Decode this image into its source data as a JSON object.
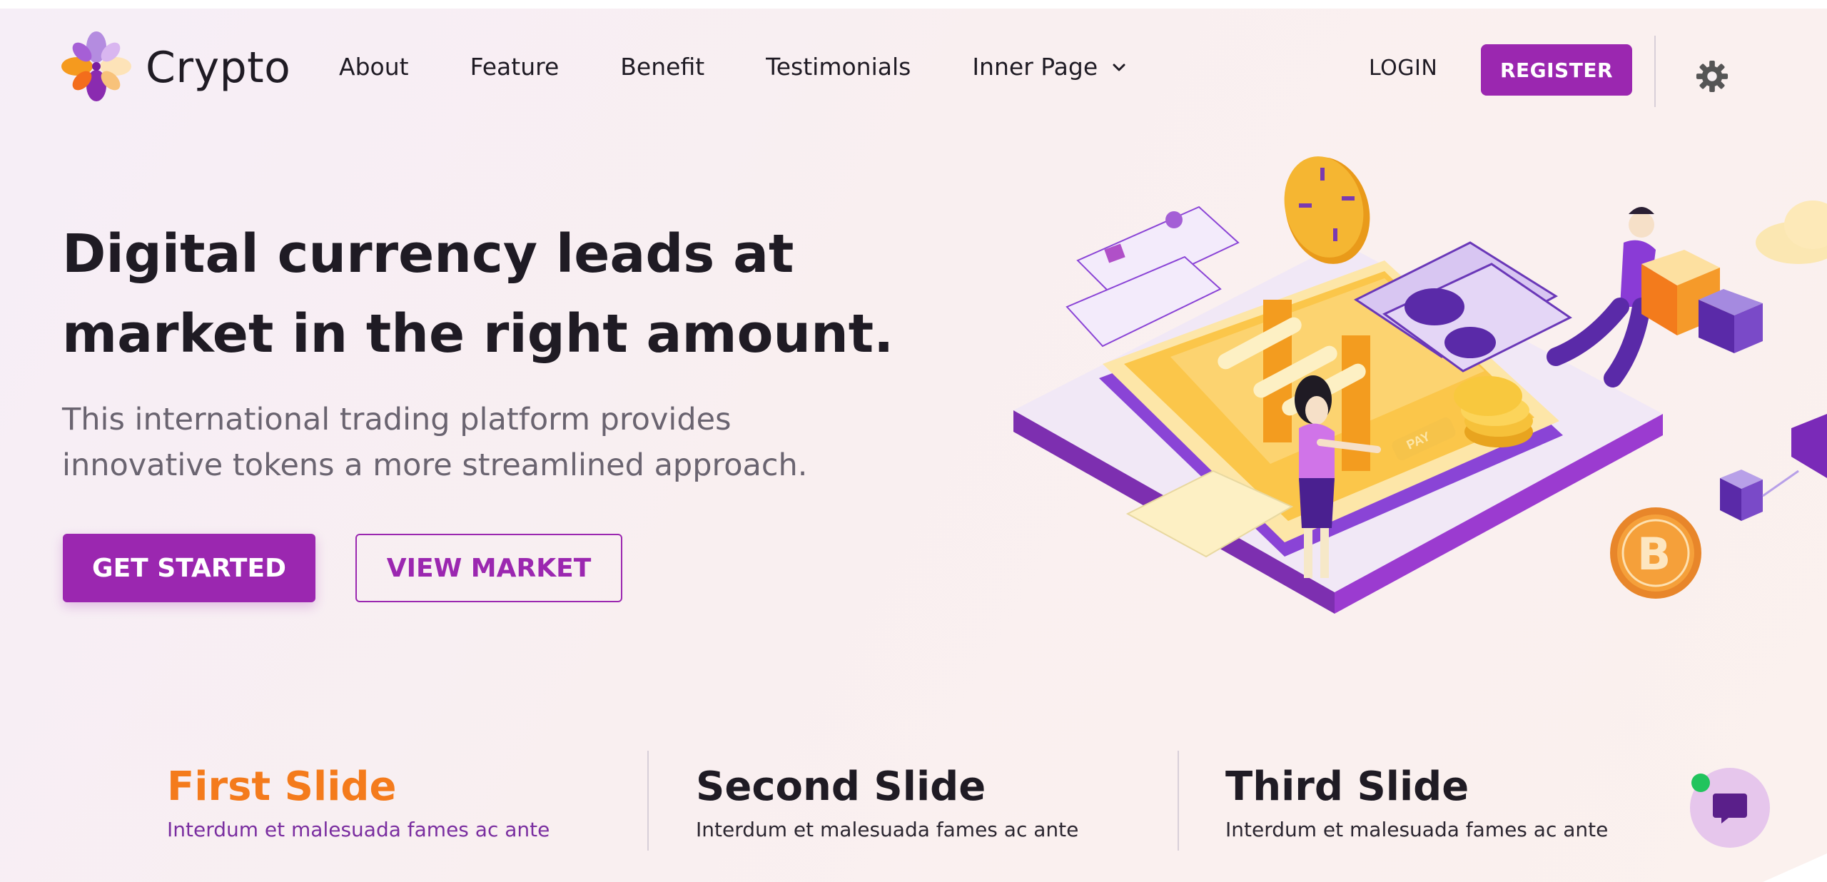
{
  "brand": {
    "name": "Crypto",
    "logo_icon": "flower-logo-icon"
  },
  "nav": {
    "items": [
      {
        "label": "About"
      },
      {
        "label": "Feature"
      },
      {
        "label": "Benefit"
      },
      {
        "label": "Testimonials"
      },
      {
        "label": "Inner Page",
        "icon": "chevron-down-icon"
      }
    ],
    "login_label": "LOGIN",
    "register_label": "REGISTER",
    "settings_icon": "gear-icon"
  },
  "hero": {
    "title_lines": [
      "Digital currency leads at",
      "market in the right amount."
    ],
    "subtitle_lines": [
      "This international trading platform provides",
      "innovative tokens a more streamlined approach."
    ],
    "primary_button": "GET STARTED",
    "secondary_button": "VIEW MARKET",
    "illustration_pay_label": "PAY"
  },
  "slides": [
    {
      "title": "First Slide",
      "text": "Interdum et malesuada fames ac ante",
      "active": true
    },
    {
      "title": "Second Slide",
      "text": "Interdum et malesuada fames ac ante",
      "active": false
    },
    {
      "title": "Third Slide",
      "text": "Interdum et malesuada fames ac ante",
      "active": false
    }
  ],
  "chat": {
    "icon": "chat-bubble-icon",
    "status": "online"
  },
  "colors": {
    "primary": "#9b27b0",
    "accent_orange": "#f47b1c",
    "text_dark": "#1f1b24",
    "text_muted": "#6a6470",
    "online_green": "#21c45d"
  }
}
